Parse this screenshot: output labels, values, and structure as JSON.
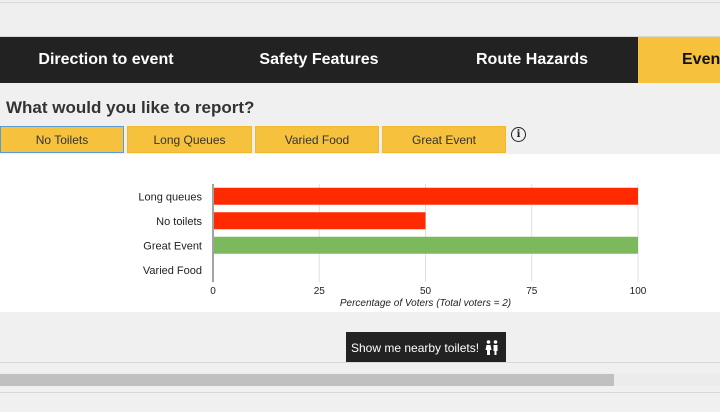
{
  "nav": {
    "tabs": [
      {
        "label": "Direction to event"
      },
      {
        "label": "Safety Features"
      },
      {
        "label": "Route Hazards"
      },
      {
        "label": "Even"
      }
    ]
  },
  "report": {
    "question": "What would you like to report?",
    "buttons": [
      {
        "label": "No Toilets"
      },
      {
        "label": "Long Queues"
      },
      {
        "label": "Varied Food"
      },
      {
        "label": "Great Event"
      }
    ],
    "info_icon": "info-icon"
  },
  "colors": {
    "accent": "#f6c23e",
    "nav_bg": "#222222",
    "bar_red": "#ff2a00",
    "bar_green": "#7cb95c"
  },
  "chart_data": {
    "type": "bar",
    "orientation": "horizontal",
    "categories": [
      "Long queues",
      "No toilets",
      "Great Event",
      "Varied Food"
    ],
    "values": [
      100,
      50,
      100,
      0
    ],
    "bar_colors": [
      "#ff2a00",
      "#ff2a00",
      "#7cb95c",
      "#7cb95c"
    ],
    "xlim": [
      0,
      100
    ],
    "xticks": [
      0,
      25,
      50,
      75,
      100
    ],
    "xlabel": "Percentage of Voters (Total voters = 2)",
    "grid": "vertical"
  },
  "toilets_button": {
    "label": "Show me nearby toilets!",
    "icon": "toilets-icon"
  }
}
